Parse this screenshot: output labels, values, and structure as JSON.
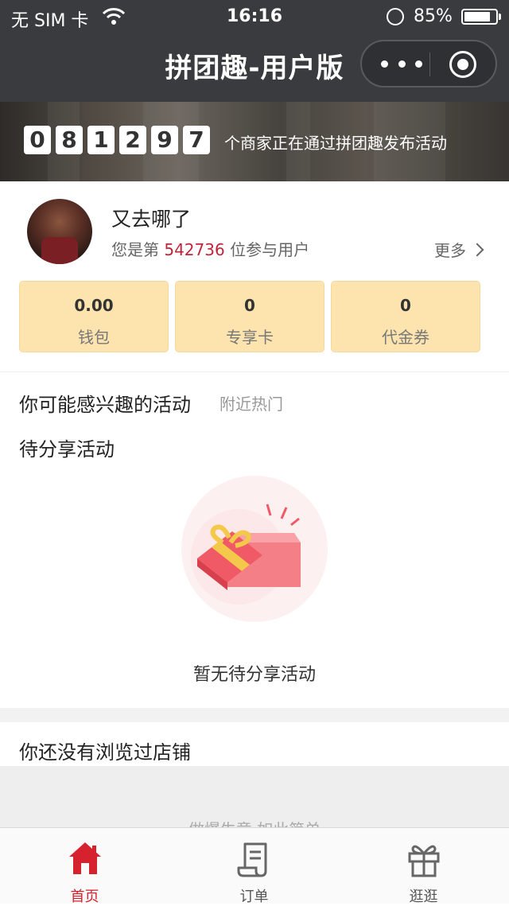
{
  "status_bar": {
    "carrier": "无 SIM 卡",
    "time": "16:16",
    "battery_text": "85%",
    "battery_level": 0.85
  },
  "nav": {
    "title": "拼团趣-用户版"
  },
  "banner": {
    "digits": [
      "0",
      "8",
      "1",
      "2",
      "9",
      "7"
    ],
    "text": "个商家正在通过拼团趣发布活动"
  },
  "user": {
    "name": "又去哪了",
    "rank_prefix": "您是第",
    "rank_number": "542736",
    "rank_suffix": "位参与用户",
    "more": "更多"
  },
  "cards": [
    {
      "value": "0.00",
      "label": "钱包"
    },
    {
      "value": "0",
      "label": "专享卡"
    },
    {
      "value": "0",
      "label": "代金券"
    }
  ],
  "sections": {
    "interest_title": "你可能感兴趣的活动",
    "interest_sub": "附近热门",
    "pending_title": "待分享活动",
    "pending_empty": "暂无待分享活动",
    "shops_title": "你还没有浏览过店铺",
    "slogan": "做爆生意 如此简单"
  },
  "tabbar": [
    {
      "label": "首页",
      "icon": "home-icon",
      "active": true
    },
    {
      "label": "订单",
      "icon": "order-icon",
      "active": false
    },
    {
      "label": "逛逛",
      "icon": "gift-icon",
      "active": false
    }
  ],
  "colors": {
    "accent": "#d6222f",
    "rank_number": "#c0263b",
    "card_bg": "#fde4ae",
    "nav_bg": "#3a3b3e"
  }
}
